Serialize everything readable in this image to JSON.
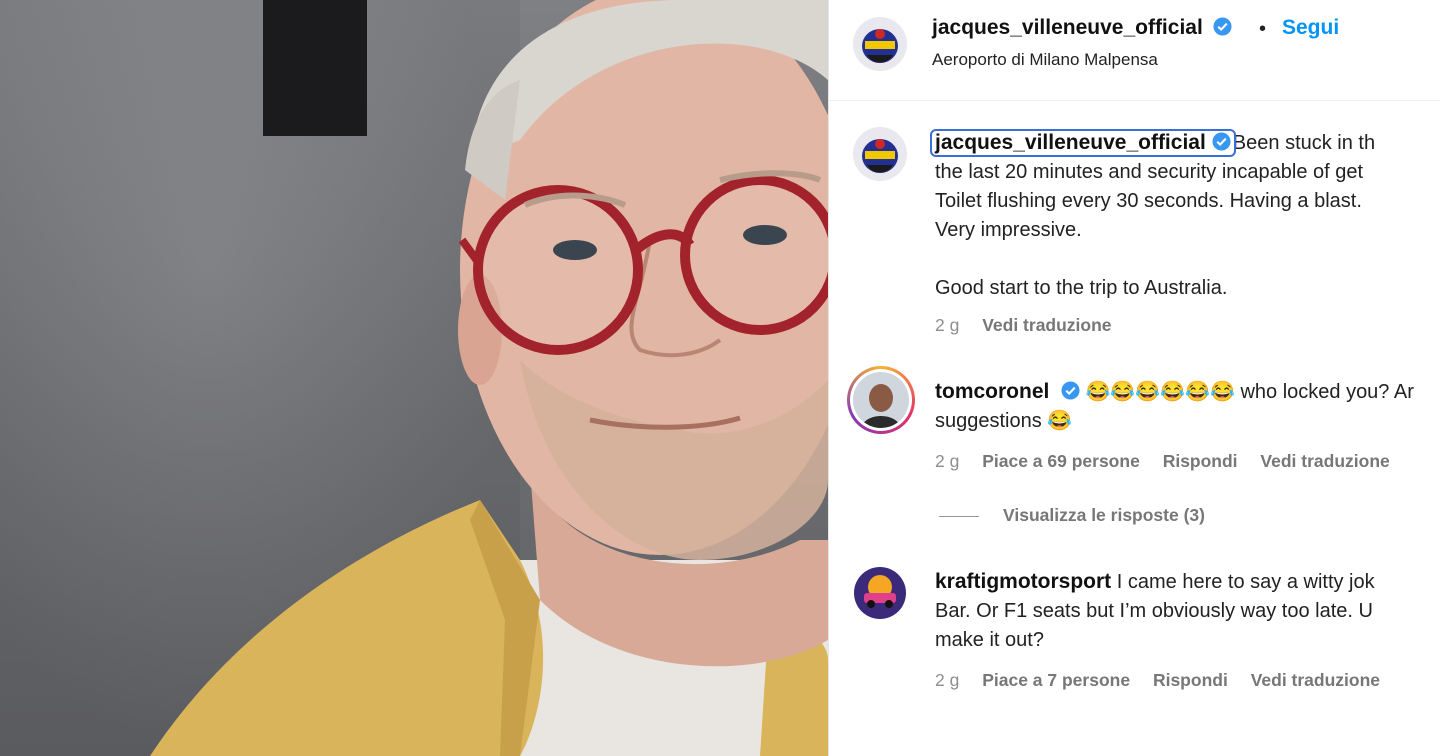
{
  "post": {
    "username": "jacques_villeneuve_official",
    "follow_label": "Segui",
    "separator": "•",
    "location": "Aeroporto di Milano Malpensa"
  },
  "caption": {
    "username": "jacques_villeneuve_official",
    "lines": [
      "Been stuck in th",
      "the last 20 minutes and security incapable of get",
      "Toilet flushing every 30 seconds. Having a blast.",
      "Very impressive.",
      "",
      "Good start to the trip to Australia."
    ],
    "time": "2 g",
    "translate_label": "Vedi traduzione"
  },
  "comments": [
    {
      "username": "tomcoronel",
      "emojis": "😂😂😂😂😂😂",
      "text_line1": " who locked you? Ar",
      "text_line2": "suggestions 😂",
      "time": "2 g",
      "likes": "Piace a 69 persone",
      "reply_label": "Rispondi",
      "translate_label": "Vedi traduzione",
      "view_replies": "Visualizza le risposte (3)"
    },
    {
      "username": "kraftigmotorsport",
      "text_line1": " I came here to say a witty jok",
      "text_line2": "Bar. Or F1 seats but I’m obviously way too late. U",
      "text_line3": "make it out?",
      "time": "2 g",
      "likes": "Piace a 7 persone",
      "reply_label": "Rispondi",
      "translate_label": "Vedi traduzione"
    }
  ],
  "colors": {
    "link_blue": "#0095f6",
    "verified_blue": "#3897f0",
    "meta_gray": "#8e8e8e",
    "highlight_outline": "#3b6fd6"
  },
  "icons": [
    "verified-badge-icon",
    "avatar"
  ]
}
